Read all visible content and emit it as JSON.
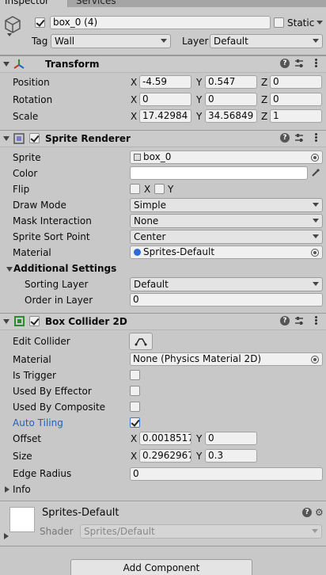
{
  "tabs": {
    "inspector": "Inspector",
    "services": "Services"
  },
  "object": {
    "name": "box_0 (4)",
    "static_label": "Static",
    "tag_label": "Tag",
    "tag_value": "Wall",
    "layer_label": "Layer",
    "layer_value": "Default"
  },
  "transform": {
    "title": "Transform",
    "position": {
      "label": "Position",
      "x": "-4.59",
      "y": "0.547",
      "z": "0"
    },
    "rotation": {
      "label": "Rotation",
      "x": "0",
      "y": "0",
      "z": "0"
    },
    "scale": {
      "label": "Scale",
      "x": "17.42984",
      "y": "34.56849",
      "z": "1"
    },
    "axis": {
      "x": "X",
      "y": "Y",
      "z": "Z"
    }
  },
  "sprite_renderer": {
    "title": "Sprite Renderer",
    "sprite_label": "Sprite",
    "sprite_value": "box_0",
    "color_label": "Color",
    "flip_label": "Flip",
    "flip_x": "X",
    "flip_y": "Y",
    "draw_mode_label": "Draw Mode",
    "draw_mode_value": "Simple",
    "mask_label": "Mask Interaction",
    "mask_value": "None",
    "sort_point_label": "Sprite Sort Point",
    "sort_point_value": "Center",
    "material_label": "Material",
    "material_value": "Sprites-Default",
    "additional_label": "Additional Settings",
    "sorting_layer_label": "Sorting Layer",
    "sorting_layer_value": "Default",
    "order_label": "Order in Layer",
    "order_value": "0"
  },
  "box_collider": {
    "title": "Box Collider 2D",
    "edit_label": "Edit Collider",
    "material_label": "Material",
    "material_value": "None (Physics Material 2D)",
    "trigger_label": "Is Trigger",
    "effector_label": "Used By Effector",
    "composite_label": "Used By Composite",
    "auto_tiling_label": "Auto Tiling",
    "offset_label": "Offset",
    "offset_x": "0.0018517",
    "offset_y": "0",
    "size_label": "Size",
    "size_x": "0.2962967",
    "size_y": "0.3",
    "edge_label": "Edge Radius",
    "edge_value": "0",
    "info_label": "Info",
    "axis": {
      "x": "X",
      "y": "Y"
    }
  },
  "material_panel": {
    "name": "Sprites-Default",
    "shader_label": "Shader",
    "shader_value": "Sprites/Default"
  },
  "add_component": "Add Component",
  "colors": {
    "accent_blue": "#1f5fbf",
    "bg": "#c8c8c8",
    "header": "#cbcbcb"
  }
}
